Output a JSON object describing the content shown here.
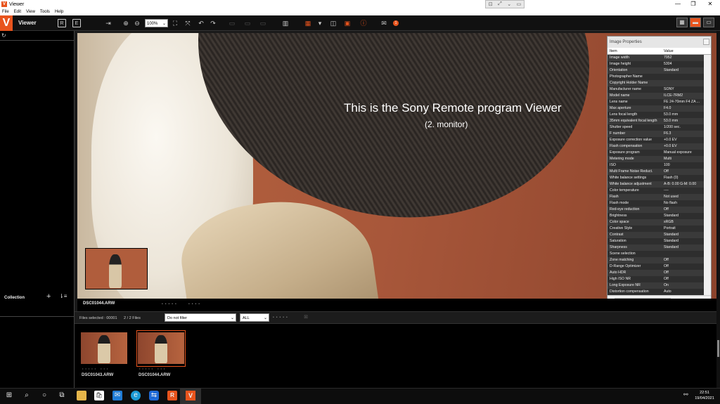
{
  "titlebar": {
    "title": "Viewer",
    "logo": "V",
    "controls": [
      "—",
      "❐",
      "✕"
    ]
  },
  "remote_bar": {
    "icons": [
      "⊡",
      "⤢",
      "⌄",
      "▭"
    ]
  },
  "menu": [
    "File",
    "Edit",
    "View",
    "Tools",
    "Help"
  ],
  "toolbar": {
    "app_title": "Viewer",
    "logo": "V",
    "zoom_value": "100%",
    "mail_badge": "1"
  },
  "sidebar": {
    "collection_label": "Collection",
    "add_icon": "+",
    "sort_icon": "⇂≡"
  },
  "viewer": {
    "overlay_title": "This is the Sony Remote program Viewer",
    "overlay_subtitle": "(2. monitor)",
    "filename": "DSC01044.ARW"
  },
  "properties": {
    "title": "Image Properties",
    "col_item": "Item",
    "col_value": "Value",
    "rows": [
      [
        "Image width",
        "7952"
      ],
      [
        "Image height",
        "5304"
      ],
      [
        "Orientation",
        "Standard"
      ],
      [
        "Photographer Name",
        ""
      ],
      [
        "Copyright Holder Name",
        ""
      ],
      [
        "Manufacturer name",
        "SONY"
      ],
      [
        "Model name",
        "ILCE-7RM2"
      ],
      [
        "Lens name",
        "FE 24-70mm F4 ZA ..."
      ],
      [
        "Max aperture",
        "F4.0"
      ],
      [
        "Lens focal length",
        "53.0 mm"
      ],
      [
        "35mm equivalent focal length",
        "53.0 mm"
      ],
      [
        "Shutter speed",
        "1/200 sec."
      ],
      [
        "F number",
        "F6.3"
      ],
      [
        "Exposure correction value",
        "+0.0 EV"
      ],
      [
        "Flash compensation",
        "+0.0 EV"
      ],
      [
        "Exposure program",
        "Manual exposure"
      ],
      [
        "Metering mode",
        "Multi"
      ],
      [
        "ISO",
        "100"
      ],
      [
        "Multi Frame Noise Reduct.",
        "Off"
      ],
      [
        "White balance settings",
        "Flash (0)"
      ],
      [
        "White balance adjustment",
        "A-B: 0.00 G-M: 0.00"
      ],
      [
        "Color temperature",
        "----"
      ],
      [
        "Flash",
        "Not used"
      ],
      [
        "Flash mode",
        "No flash"
      ],
      [
        "Red-eye reduction",
        "Off"
      ],
      [
        "Brightness",
        "Standard"
      ],
      [
        "Color space",
        "sRGB"
      ],
      [
        "Creative Style",
        "Portrait"
      ],
      [
        "Contrast",
        "Standard"
      ],
      [
        "Saturation",
        "Standard"
      ],
      [
        "Sharpness",
        "Standard"
      ],
      [
        "Scene selection",
        ""
      ],
      [
        "Zone matching",
        "Off"
      ],
      [
        "D-Range Optimizer",
        "Off"
      ],
      [
        "Auto HDR",
        "Off"
      ],
      [
        "High ISO NR",
        "Off"
      ],
      [
        "Long Exposure NR",
        "On"
      ],
      [
        "Distortion compensation",
        "Auto"
      ]
    ]
  },
  "filterbar": {
    "files_selected": "Files selected : 00001",
    "file_count": "2 / 2 Files",
    "filter_value": "Do not filter",
    "rating_value": "ALL"
  },
  "filmstrip": {
    "items": [
      "DSC01043.ARW",
      "DSC01044.ARW"
    ]
  },
  "taskbar": {
    "time": "22:51",
    "date": "19/04/2021"
  },
  "colors": {
    "accent": "#e8541d",
    "background": "#1a1a1a"
  }
}
